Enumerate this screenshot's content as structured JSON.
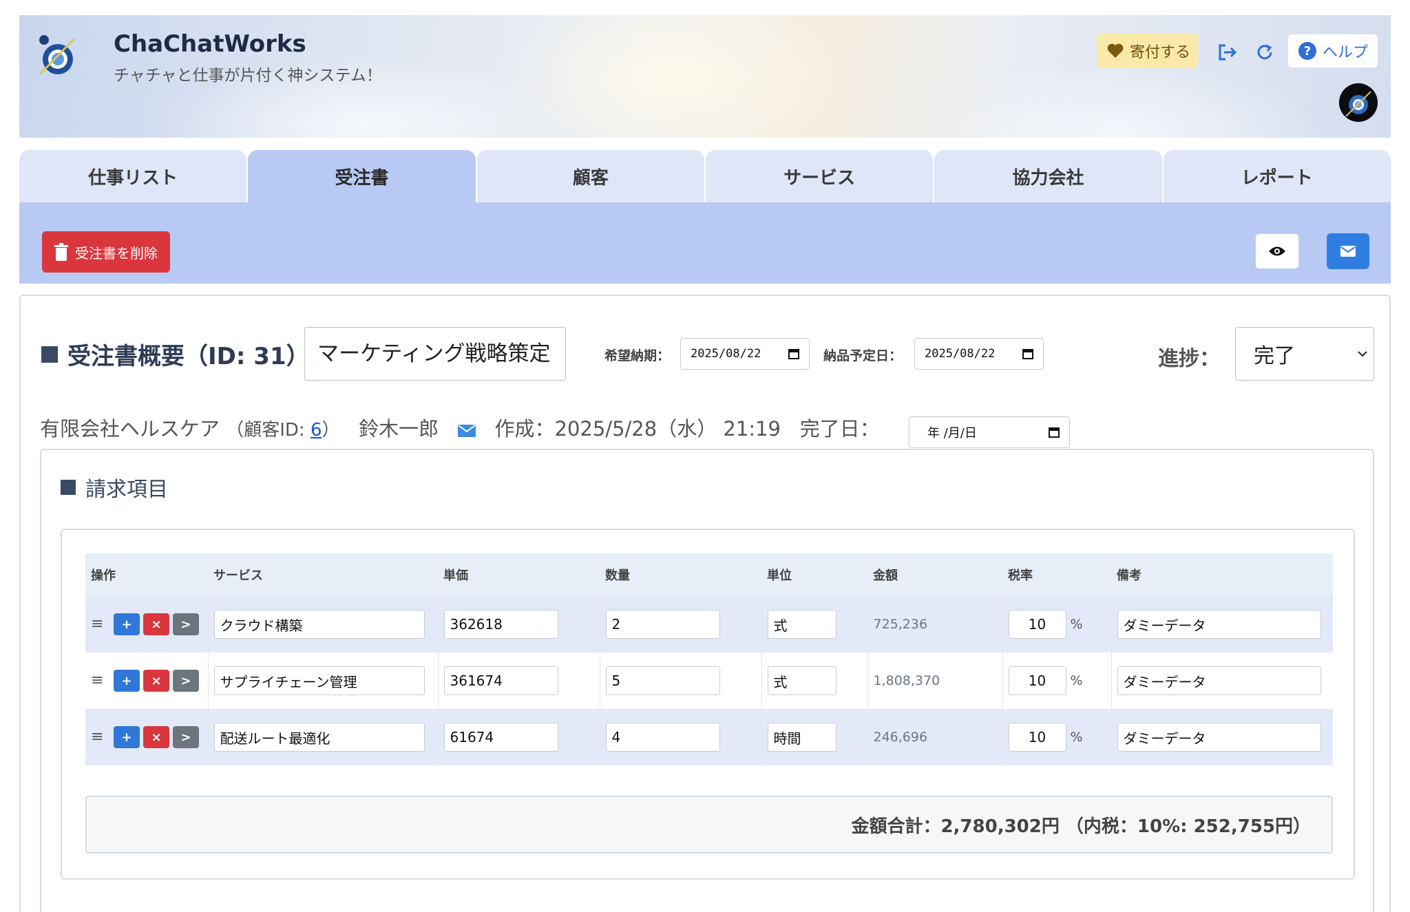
{
  "app": {
    "title": "ChaChatWorks",
    "subtitle": "チャチャと仕事が片付く神システム！"
  },
  "header": {
    "donate_label": "寄付する",
    "help_label": "ヘルプ",
    "icons": [
      "heart-icon",
      "logout-icon",
      "refresh-icon",
      "question-icon"
    ]
  },
  "tabs": [
    {
      "label": "仕事リスト",
      "active": false
    },
    {
      "label": "受注書",
      "active": true
    },
    {
      "label": "顧客",
      "active": false
    },
    {
      "label": "サービス",
      "active": false
    },
    {
      "label": "協力会社",
      "active": false
    },
    {
      "label": "レポート",
      "active": false
    }
  ],
  "toolbar": {
    "delete_label": "受注書を削除"
  },
  "overview": {
    "title": "受注書概要（ID: 31）",
    "name_value": "マーケティング戦略策定",
    "desired_date_label": "希望納期：",
    "desired_date_value": "2025/08/22",
    "delivery_date_label": "納品予定日：",
    "delivery_date_value": "2025/08/22",
    "progress_label": "進捗：",
    "progress_value": "完了"
  },
  "info": {
    "customer_name": "有限会社ヘルスケア",
    "customer_id_prefix": "（顧客ID: ",
    "customer_id": "6",
    "customer_id_suffix": "）",
    "contact": "鈴木一郎",
    "created": "作成：2025/5/28（水） 21:19",
    "completed_label": "完了日：",
    "completed_placeholder": "年 /月/日"
  },
  "billing": {
    "title": "請求項目",
    "columns": [
      "操作",
      "サービス",
      "単価",
      "数量",
      "単位",
      "金額",
      "税率",
      "備考"
    ],
    "rows": [
      {
        "service": "クラウド構築",
        "unit_price": "362618",
        "qty": "2",
        "unit": "式",
        "amount": "725,236",
        "tax": "10",
        "note": "ダミーデータ"
      },
      {
        "service": "サプライチェーン管理",
        "unit_price": "361674",
        "qty": "5",
        "unit": "式",
        "amount": "1,808,370",
        "tax": "10",
        "note": "ダミーデータ"
      },
      {
        "service": "配送ルート最適化",
        "unit_price": "61674",
        "qty": "4",
        "unit": "時間",
        "amount": "246,696",
        "tax": "10",
        "note": "ダミーデータ"
      }
    ],
    "pct_symbol": "%",
    "op_labels": {
      "add": "+",
      "delete": "×",
      "go": ">"
    },
    "total": "金額合計：2,780,302円 （内税：10%: 252,755円）"
  },
  "colors": {
    "tab_active": "#b8c9f4",
    "tab_inactive": "#dfe6f7",
    "danger": "#d9363e",
    "primary": "#2f7de1"
  }
}
